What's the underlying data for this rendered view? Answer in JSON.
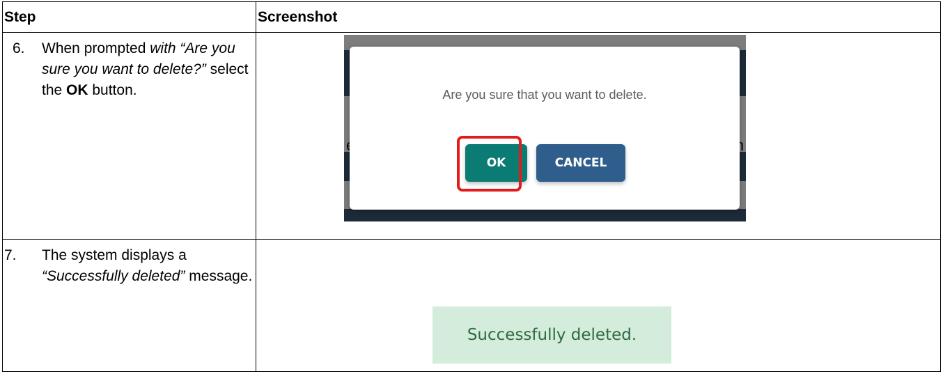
{
  "table": {
    "header": {
      "step": "Step",
      "screenshot": "Screenshot"
    },
    "rows": [
      {
        "number": "6.",
        "text_prefix": "When prompted ",
        "text_italic": "with “Are you sure you want to delete?”",
        "text_middle": " select the ",
        "text_bold": "OK",
        "text_suffix": " button.",
        "screenshot": {
          "modal_message": "Are you sure that you want to delete.",
          "ok_label": "OK",
          "cancel_label": "CANCEL",
          "ok_color": "#0b7c74",
          "cancel_color": "#2f5e8c",
          "highlight_color": "#e21b1b",
          "left_edge_glyph": "e",
          "right_edge_glyph": "n"
        }
      },
      {
        "number": "7.",
        "text_prefix": "The system displays a ",
        "text_italic": "“Successfully deleted”",
        "text_suffix": " message.",
        "screenshot": {
          "banner_text": "Successfully deleted.",
          "banner_color": "#d4ecdb"
        }
      }
    ]
  }
}
